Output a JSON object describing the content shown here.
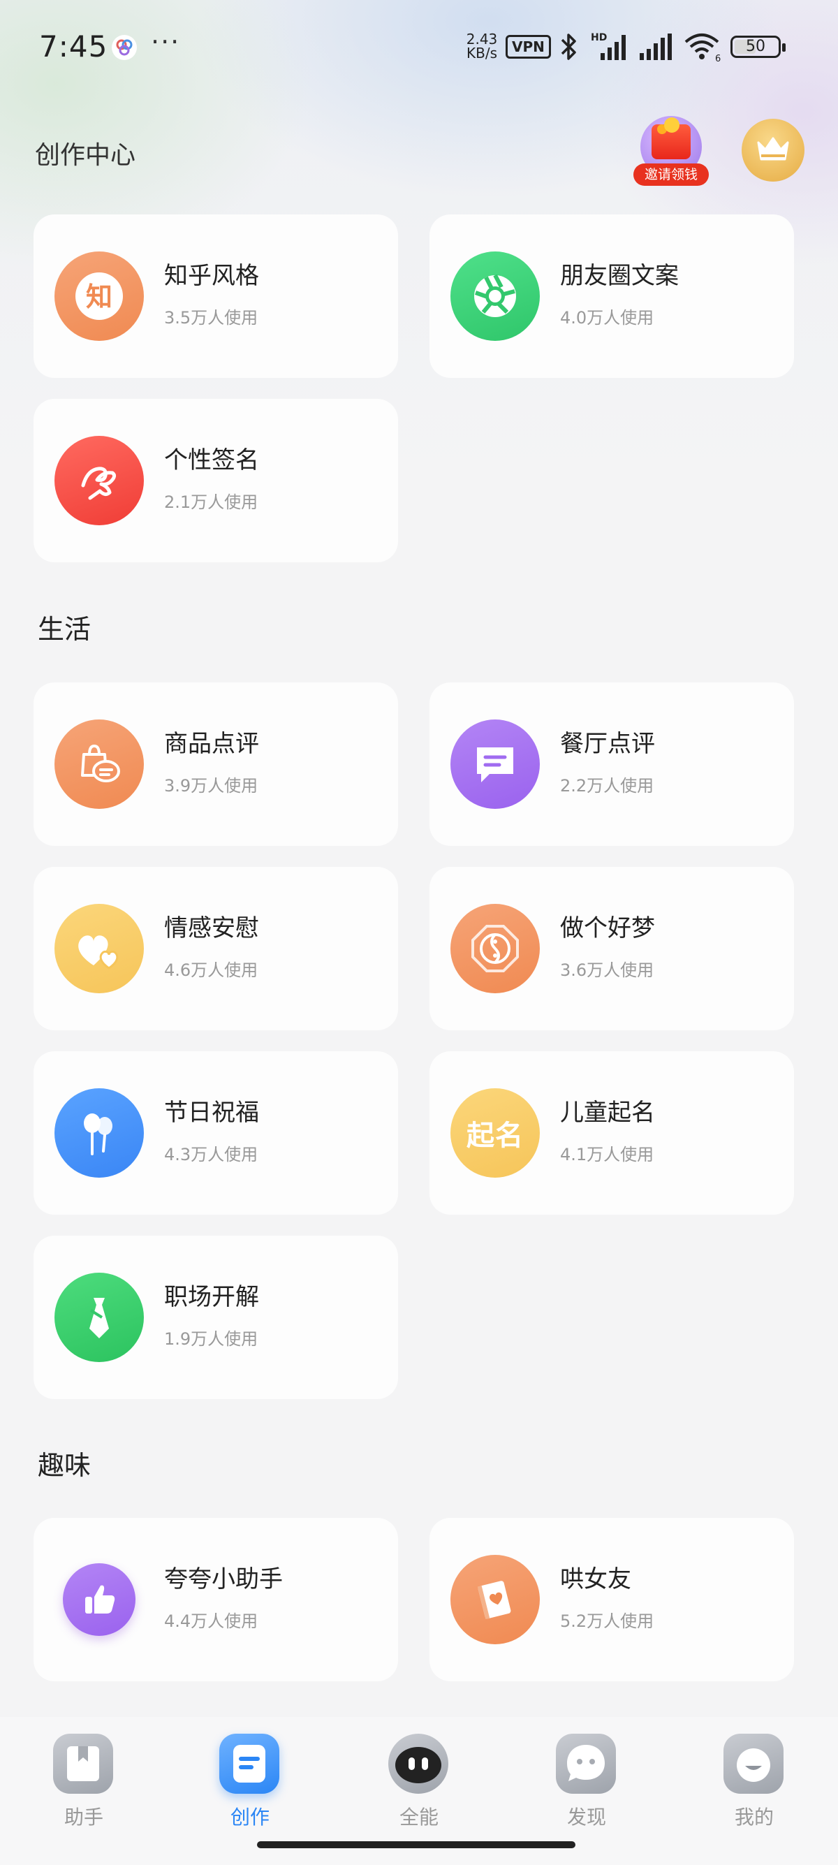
{
  "status_bar": {
    "time": "7:45",
    "more": "···",
    "net_speed_value": "2.43",
    "net_speed_unit": "KB/s",
    "vpn": "VPN",
    "wifi_tag": "6",
    "hd_tag": "HD",
    "battery": "50",
    "battery_level": 0.5
  },
  "header": {
    "title": "创作中心",
    "invite_label": "邀请领钱"
  },
  "sections": {
    "top": [
      {
        "name": "知乎风格",
        "usage": "3.5万人使用",
        "icon": "zhihu-char-icon",
        "icon_text": "知",
        "color": "#f08a52"
      },
      {
        "name": "朋友圈文案",
        "usage": "4.0万人使用",
        "icon": "camera-aperture-icon",
        "color": "#2fc66a"
      },
      {
        "name": "个性签名",
        "usage": "2.1万人使用",
        "icon": "signature-icon",
        "color": "#f03d36"
      }
    ],
    "life_title": "生活",
    "life": [
      {
        "name": "商品点评",
        "usage": "3.9万人使用",
        "icon": "shopping-bag-comment-icon",
        "color": "#f08a52"
      },
      {
        "name": "餐厅点评",
        "usage": "2.2万人使用",
        "icon": "chat-bubble-icon",
        "color": "#9a62ee"
      },
      {
        "name": "情感安慰",
        "usage": "4.6万人使用",
        "icon": "hearts-icon",
        "color": "#f6c55a"
      },
      {
        "name": "做个好梦",
        "usage": "3.6万人使用",
        "icon": "bagua-icon",
        "color": "#f08a52"
      },
      {
        "name": "节日祝福",
        "usage": "4.3万人使用",
        "icon": "balloons-icon",
        "color": "#3a86f5"
      },
      {
        "name": "儿童起名",
        "usage": "4.1万人使用",
        "icon": "naming-text-icon",
        "icon_text": "起名",
        "color": "#f6c55a"
      },
      {
        "name": "职场开解",
        "usage": "1.9万人使用",
        "icon": "necktie-icon",
        "color": "#2cc35f"
      }
    ],
    "fun_title": "趣味",
    "fun": [
      {
        "name": "夸夸小助手",
        "usage": "4.4万人使用",
        "icon": "thumbs-up-icon",
        "color": "#9a62ee"
      },
      {
        "name": "哄女友",
        "usage": "5.2万人使用",
        "icon": "love-book-icon",
        "color": "#f08a52"
      }
    ]
  },
  "bottom_nav": [
    {
      "label": "助手",
      "icon": "assistant-book-icon",
      "active": false
    },
    {
      "label": "创作",
      "icon": "create-doc-icon",
      "active": true
    },
    {
      "label": "全能",
      "icon": "robot-face-icon",
      "active": false
    },
    {
      "label": "发现",
      "icon": "discover-chat-icon",
      "active": false
    },
    {
      "label": "我的",
      "icon": "profile-face-icon",
      "active": false
    }
  ]
}
